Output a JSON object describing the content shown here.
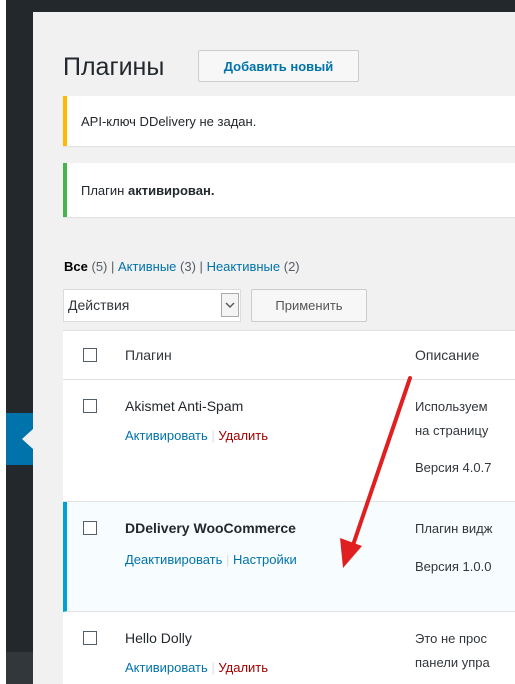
{
  "colors": {
    "sidebar": "#23282d",
    "accent": "#0073aa",
    "warning": "#ffb900",
    "success": "#46b450",
    "delete": "#a00000",
    "active_row_border": "#00a0d2",
    "annotation_arrow": "#e02020"
  },
  "header": {
    "title": "Плагины",
    "add_new_label": "Добавить новый"
  },
  "notices": {
    "warning_text": "API-ключ DDelivery не задан.",
    "success_prefix": "Плагин ",
    "success_strong": "активирован."
  },
  "filters": {
    "all_label": "Все",
    "all_count": "(5)",
    "active_label": "Активные",
    "active_count": "(3)",
    "inactive_label": "Неактивные",
    "inactive_count": "(2)",
    "separator": "|"
  },
  "bulk": {
    "select_value": "Действия",
    "apply_label": "Применить",
    "arrow_icon": "chevron-down-icon"
  },
  "table": {
    "col_plugin": "Плагин",
    "col_description": "Описание",
    "rows": [
      {
        "name": "Akismet Anti-Spam",
        "action1": "Активировать",
        "action2": "Удалить",
        "desc1": "Используем",
        "desc2": "на страницу",
        "version": "Версия 4.0.7"
      },
      {
        "name": "DDelivery WooCommerce",
        "action1": "Деактивировать",
        "action2": "Настройки",
        "desc1": "Плагин видж",
        "version": "Версия 1.0.0"
      },
      {
        "name": "Hello Dolly",
        "action1": "Активировать",
        "action2": "Удалить",
        "desc1": "Это не прос",
        "desc2": "панели упра"
      }
    ]
  }
}
